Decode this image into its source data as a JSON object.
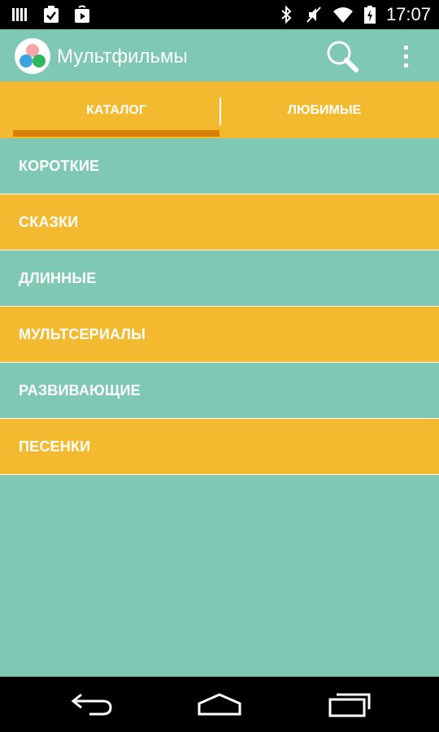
{
  "status_bar": {
    "time": "17:07",
    "left_icons": [
      "signal-bars-icon",
      "clipboard-check-icon",
      "play-store-icon"
    ],
    "right_icons": [
      "bluetooth-icon",
      "mute-icon",
      "wifi-icon",
      "battery-charging-icon"
    ]
  },
  "action_bar": {
    "title": "Мультфильмы",
    "search_icon": "search-icon",
    "overflow_icon": "overflow-menu-icon"
  },
  "tabs": {
    "items": [
      {
        "label": "КАТАЛОГ",
        "selected": true
      },
      {
        "label": "ЛЮБИМЫЕ",
        "selected": false
      }
    ]
  },
  "categories": {
    "items": [
      {
        "label": "КОРОТКИЕ"
      },
      {
        "label": "СКАЗКИ"
      },
      {
        "label": "ДЛИННЫЕ"
      },
      {
        "label": "МУЛЬТСЕРИАЛЫ"
      },
      {
        "label": "РАЗВИВАЮЩИЕ"
      },
      {
        "label": "ПЕСЕНКИ"
      }
    ]
  },
  "colors": {
    "teal": "#7fc8b4",
    "yellow": "#f3ba2f",
    "tab_indicator": "#d77f08"
  },
  "nav_bar": {
    "icons": [
      "back-icon",
      "home-icon",
      "recent-apps-icon"
    ]
  }
}
